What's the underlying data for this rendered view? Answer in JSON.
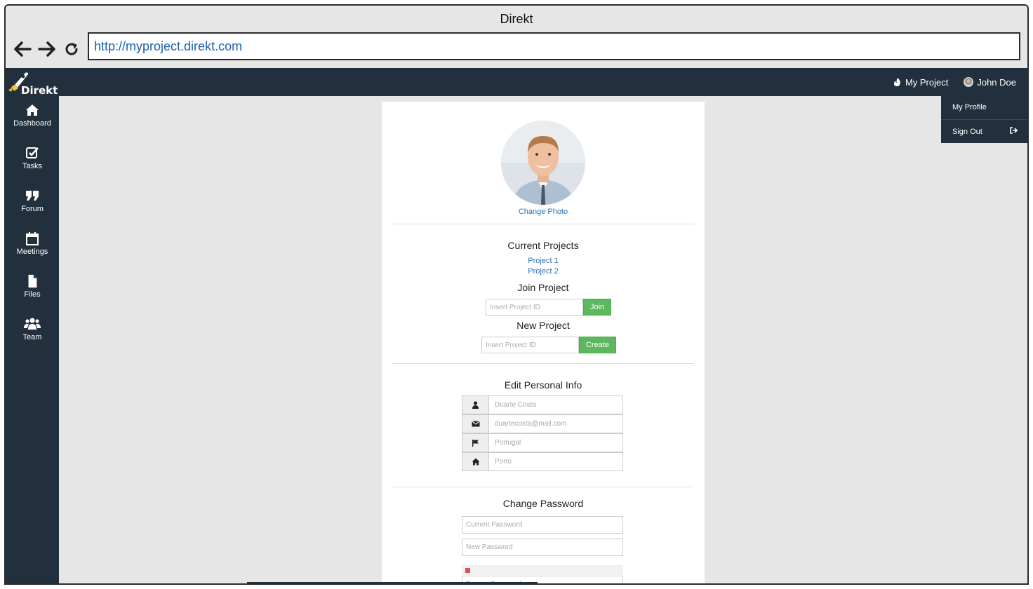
{
  "browser": {
    "title": "Direkt",
    "url": "http://myproject.direkt.com"
  },
  "brand": {
    "name": "Direkt",
    "accent": "#f2c744"
  },
  "topnav": {
    "project": "My Project",
    "user": "John Doe"
  },
  "dropdown": {
    "items": [
      {
        "label": "My Profile"
      },
      {
        "label": "Sign Out"
      }
    ]
  },
  "sidebar": {
    "items": [
      {
        "label": "Dashboard",
        "icon": "home-icon"
      },
      {
        "label": "Tasks",
        "icon": "check-square-icon"
      },
      {
        "label": "Forum",
        "icon": "quote-icon"
      },
      {
        "label": "Meetings",
        "icon": "calendar-icon"
      },
      {
        "label": "Files",
        "icon": "file-icon"
      },
      {
        "label": "Team",
        "icon": "users-icon"
      }
    ]
  },
  "profile": {
    "change_photo": "Change Photo",
    "current_projects_title": "Current Projects",
    "projects": [
      "Project 1",
      "Project 2"
    ],
    "join_title": "Join Project",
    "join_placeholder": "Insert Project ID",
    "join_button": "Join",
    "new_title": "New Project",
    "new_placeholder": "Insert Project ID",
    "create_button": "Create",
    "edit_title": "Edit Personal Info",
    "fields": {
      "name": "Duarte Costa",
      "email": "duartecosta@mail.com",
      "country": "Portugal",
      "city": "Porto"
    },
    "password_title": "Change Password",
    "current_password": "Current Password",
    "new_password": "New Password",
    "repeat_password": "Repeat Password"
  },
  "colors": {
    "sidebar_bg": "#22303e",
    "link": "#2a6fb5",
    "button_green": "#5cb85c",
    "strength_weak": "#d9534f"
  }
}
